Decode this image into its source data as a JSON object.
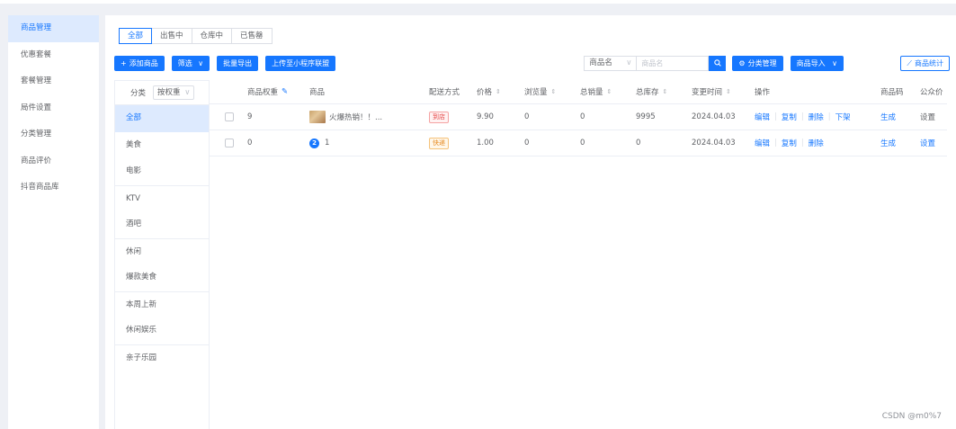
{
  "sidebar": {
    "items": [
      {
        "label": "商品管理",
        "active": true
      },
      {
        "label": "优惠套餐"
      },
      {
        "label": "套餐管理"
      },
      {
        "label": "局件设置"
      },
      {
        "label": "分类管理"
      },
      {
        "label": "商品评价"
      },
      {
        "label": "抖音商品库"
      }
    ]
  },
  "tabs": [
    {
      "label": "全部",
      "active": true
    },
    {
      "label": "出售中"
    },
    {
      "label": "仓库中"
    },
    {
      "label": "已售罄"
    }
  ],
  "toolbar": {
    "add_icon": "+",
    "add_label": "添加商品",
    "filter_label": "筛选",
    "filter_caret": "∨",
    "export_label": "批量导出",
    "upload_label": "上传至小程序联盟"
  },
  "search": {
    "field_label": "商品名",
    "field_caret": "∨",
    "placeholder": "商品名",
    "search_icon": "search-icon",
    "category_manage_icon": "⚙",
    "category_manage_label": "分类管理",
    "import_label": "商品导入",
    "import_caret": "∨",
    "stats_icon": "⟋",
    "stats_label": "商品统计"
  },
  "category_panel": {
    "header_label": "分类",
    "sort_label": "按权重",
    "sort_caret": "∨",
    "items": [
      {
        "label": "全部",
        "active": true
      },
      {
        "label": "美食"
      },
      {
        "label": "电影"
      },
      {
        "label": "KTV"
      },
      {
        "label": "酒吧"
      },
      {
        "label": "休闲"
      },
      {
        "label": "爆款美食"
      },
      {
        "label": "本周上新"
      },
      {
        "label": "休闲娱乐"
      },
      {
        "label": "亲子乐园"
      }
    ]
  },
  "table": {
    "headers": {
      "weight": "商品权重",
      "weight_edit_icon": "✎",
      "product": "商品",
      "delivery": "配送方式",
      "price": "价格",
      "views": "浏览量",
      "sales": "总销量",
      "stock": "总库存",
      "updated": "变更时间",
      "actions": "操作",
      "code": "商品码",
      "public_price": "公众价"
    },
    "sort_icon": "⇕",
    "rows": [
      {
        "weight": "9",
        "product_name": "火爆热销！！...",
        "product_icon": "product-thumbnail",
        "delivery": "到店",
        "delivery_style": "red",
        "price": "9.90",
        "views": "0",
        "sales": "0",
        "stock": "9995",
        "updated": "2024.04.03",
        "actions": [
          "编辑",
          "复制",
          "删除",
          "下架"
        ],
        "code": "生成",
        "public_price": "设置"
      },
      {
        "weight": "0",
        "product_name": "1",
        "product_icon": "2",
        "delivery": "快递",
        "delivery_style": "orange",
        "price": "1.00",
        "views": "0",
        "sales": "0",
        "stock": "0",
        "updated": "2024.04.03",
        "actions": [
          "编辑",
          "复制",
          "删除"
        ],
        "code": "生成",
        "public_price": "设置"
      }
    ]
  },
  "watermark": "CSDN @m0%7"
}
